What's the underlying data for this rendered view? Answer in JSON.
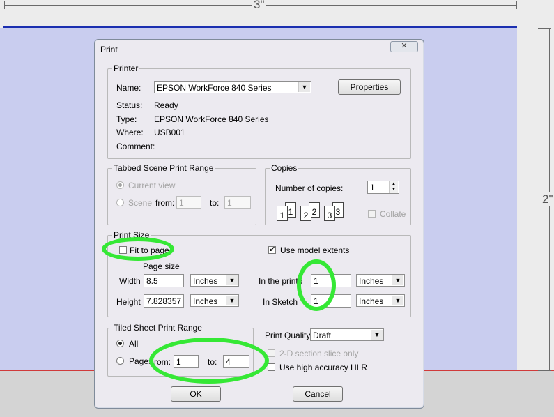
{
  "canvas": {
    "dimension_width": "3\"",
    "dimension_height": "2\""
  },
  "dialog": {
    "title": "Print",
    "close_glyph": "✕",
    "printer": {
      "legend": "Printer",
      "name_label": "Name:",
      "name_value": "EPSON WorkForce 840 Series",
      "properties_label": "Properties",
      "status_label": "Status:",
      "status_value": "Ready",
      "type_label": "Type:",
      "type_value": "EPSON WorkForce 840 Series",
      "where_label": "Where:",
      "where_value": "USB001",
      "comment_label": "Comment:"
    },
    "tabbed_range": {
      "legend": "Tabbed Scene Print Range",
      "current_view_label": "Current view",
      "scenes_label": "Scene",
      "from_label": "from:",
      "from_value": "1",
      "to_label": "to:",
      "to_value": "1"
    },
    "copies": {
      "legend": "Copies",
      "count_label": "Number of copies:",
      "count_value": "1",
      "collate_label": "Collate",
      "icon_digits": [
        "1",
        "1",
        "2",
        "2",
        "3",
        "3"
      ]
    },
    "print_size": {
      "legend": "Print Size",
      "fit_label": "Fit to page",
      "model_extents_label": "Use model extents",
      "page_size_label": "Page size",
      "width_label": "Width",
      "width_value": "8.5",
      "width_unit": "Inches",
      "height_label": "Height",
      "height_value": "7.828357",
      "height_unit": "Inches",
      "in_printout_label": "In the printo",
      "in_printout_value": "1",
      "in_printout_unit": "Inches",
      "in_sketchup_label": "In Sketch",
      "in_sketchup_value": "1",
      "in_sketchup_unit": "Inches"
    },
    "tiled_range": {
      "legend": "Tiled Sheet Print Range",
      "all_label": "All",
      "pages_label": "Pages",
      "from_label": "rom:",
      "from_value": "1",
      "to_label": "to:",
      "to_value": "4"
    },
    "quality": {
      "label": "Print Quality",
      "value": "Draft",
      "section_slice_label": "2-D section slice only",
      "hlr_label": "Use high accuracy HLR"
    },
    "ok_label": "OK",
    "cancel_label": "Cancel"
  },
  "colors": {
    "highlight": "#35e835",
    "page_fill": "#c9cdef",
    "blue_edge": "#1b2fb0",
    "red_axis": "#d03a3a"
  },
  "icons": {
    "dropdown": "chevron-down-icon",
    "spinner": "spinner-arrows-icon",
    "copies": "collate-pages-icon",
    "check": "checkmark-icon",
    "close": "close-icon"
  }
}
